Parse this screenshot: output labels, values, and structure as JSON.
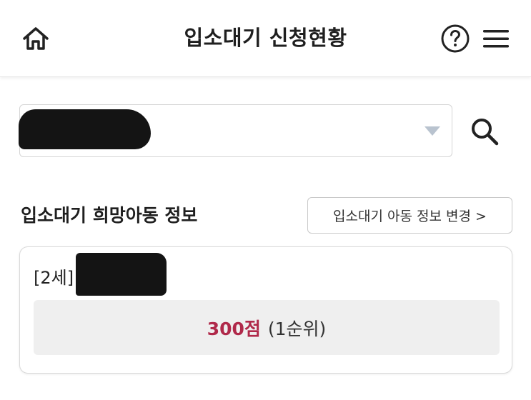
{
  "header": {
    "title": "입소대기 신청현황",
    "home_icon": "home-icon",
    "help_icon": "help-circle-icon",
    "menu_icon": "hamburger-menu-icon"
  },
  "filter": {
    "selected_value": "",
    "value_redacted": true,
    "dropdown_icon": "triangle-down-icon",
    "search_icon": "search-icon"
  },
  "section": {
    "title": "입소대기 희망아동 정보",
    "change_button_label": "입소대기 아동 정보 변경 >"
  },
  "child": {
    "age_label": "[2세]",
    "name_redacted": true,
    "score": "300점",
    "rank": "(1순위)"
  },
  "colors": {
    "accent": "#b0294a",
    "score_bg": "#efefef",
    "dropdown_arrow": "#b9c3cf",
    "border": "#d5d5d5"
  }
}
